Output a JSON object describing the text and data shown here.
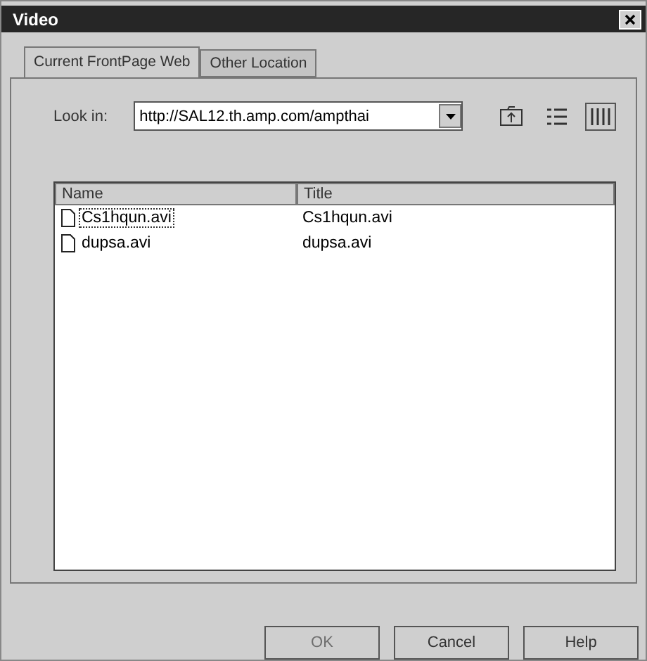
{
  "window": {
    "title": "Video"
  },
  "tabs": [
    {
      "label": "Current FrontPage Web",
      "selected": true
    },
    {
      "label": "Other Location",
      "selected": false
    }
  ],
  "look_in": {
    "label": "Look in:",
    "value": "http://SAL12.th.amp.com/ampthai"
  },
  "table": {
    "columns": [
      "Name",
      "Title"
    ],
    "rows": [
      {
        "name": "Cs1hqun.avi",
        "title": "Cs1hqun.avi",
        "selected": true
      },
      {
        "name": "dupsa.avi",
        "title": "dupsa.avi",
        "selected": false
      }
    ]
  },
  "buttons": [
    {
      "label": "OK",
      "disabled": true
    },
    {
      "label": "Cancel",
      "disabled": false
    },
    {
      "label": "Help",
      "disabled": false
    }
  ]
}
